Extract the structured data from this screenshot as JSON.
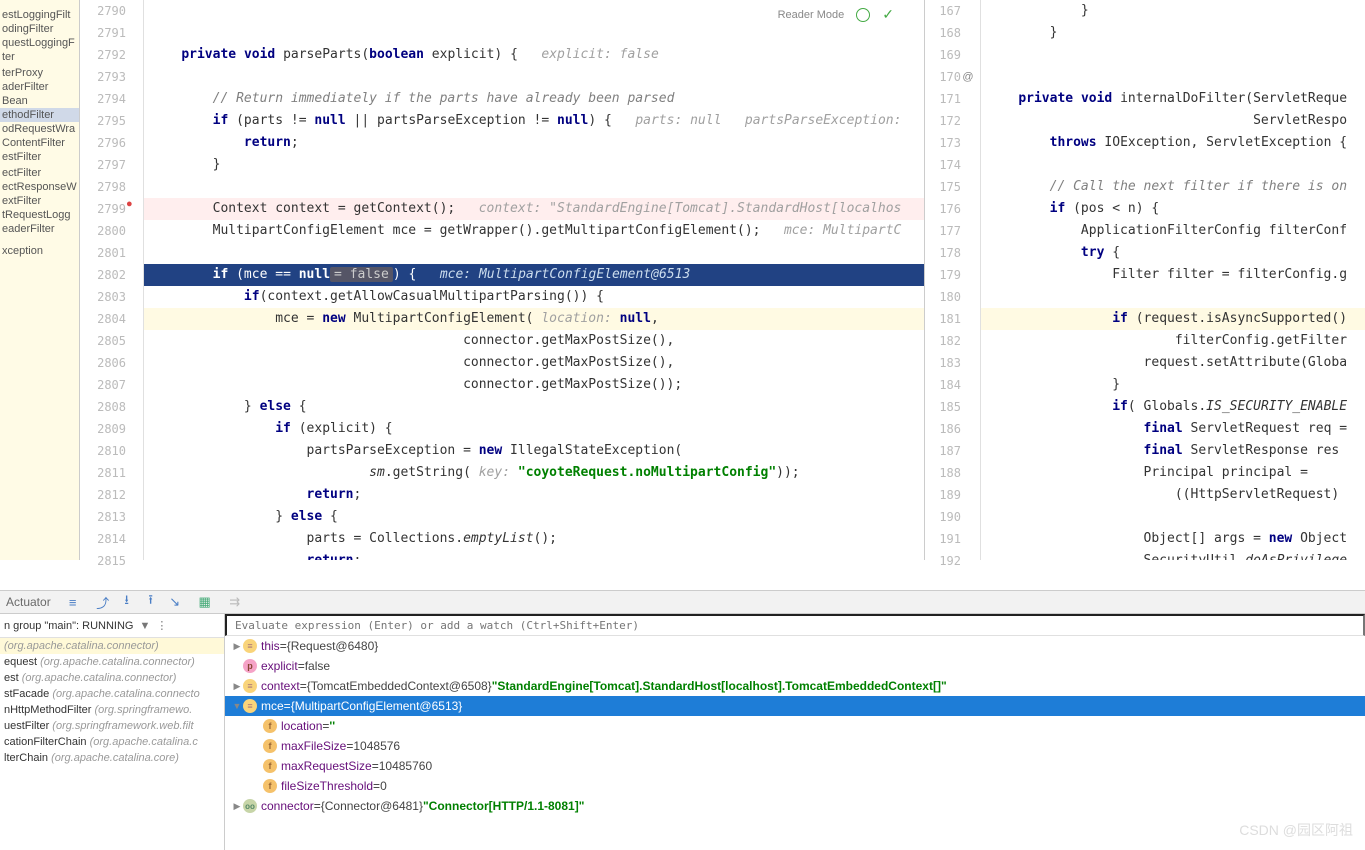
{
  "reader_mode": "Reader Mode",
  "structure": [
    {
      "t": ""
    },
    {
      "t": ""
    },
    {
      "t": "estLoggingFilt"
    },
    {
      "t": "odingFilter"
    },
    {
      "t": "questLoggingF"
    },
    {
      "t": "ter"
    },
    {
      "t": ""
    },
    {
      "t": "terProxy"
    },
    {
      "t": "aderFilter"
    },
    {
      "t": "Bean"
    },
    {
      "t": "ethodFilter",
      "sel": true
    },
    {
      "t": "odRequestWra"
    },
    {
      "t": "ContentFilter"
    },
    {
      "t": "estFilter"
    },
    {
      "t": ""
    },
    {
      "t": "ectFilter"
    },
    {
      "t": "ectResponseW"
    },
    {
      "t": "extFilter"
    },
    {
      "t": "tRequestLogg"
    },
    {
      "t": "eaderFilter"
    },
    {
      "t": ""
    },
    {
      "t": ""
    },
    {
      "t": ""
    },
    {
      "t": ""
    },
    {
      "t": "xception"
    }
  ],
  "leftGutterStart": 2790,
  "rightGutterStart": 167,
  "rightAnnotations": {
    "170": "@"
  },
  "leftLines": [
    {
      "tokens": [
        ""
      ]
    },
    {
      "tokens": [
        ""
      ]
    },
    {
      "tokens": [
        "    ",
        "private ",
        "kw",
        "void ",
        "kw",
        "parseParts(",
        "boolean ",
        "kw",
        "explicit) {   ",
        "explicit: false",
        "hint"
      ]
    },
    {
      "tokens": [
        ""
      ]
    },
    {
      "tokens": [
        "        ",
        "// Return immediately if the parts have already been parsed",
        "cm"
      ]
    },
    {
      "tokens": [
        "        ",
        "if ",
        "kw",
        "(parts != ",
        "null ",
        "kw",
        "|| partsParseException != ",
        "null",
        "kw",
        ") {   ",
        "parts: null   partsParseException:",
        "hint"
      ]
    },
    {
      "tokens": [
        "            ",
        "return",
        "kw",
        ";"
      ]
    },
    {
      "tokens": [
        "        }"
      ]
    },
    {
      "tokens": [
        ""
      ]
    },
    {
      "tokens": [
        "        Context context = getContext();   ",
        "context: \"StandardEngine[Tomcat].StandardHost[localhos",
        "hint"
      ],
      "bp": true
    },
    {
      "tokens": [
        "        MultipartConfigElement mce = getWrapper().getMultipartConfigElement();   ",
        "mce: MultipartC",
        "hint"
      ]
    },
    {
      "tokens": [
        ""
      ]
    },
    {
      "sel": true,
      "tokens": [
        "        ",
        "if ",
        "kw",
        "(mce == ",
        "null",
        "kw",
        "= false",
        "pill",
        ") {   ",
        "mce: MultipartConfigElement@6513",
        "hint"
      ]
    },
    {
      "tokens": [
        "            ",
        "if",
        "kw",
        "(context.getAllowCasualMultipartParsing()) {"
      ]
    },
    {
      "tokens": [
        "                mce = ",
        "new ",
        "kw",
        "MultipartConfigElement( ",
        "location: ",
        "hint",
        "null",
        "kw",
        ","
      ],
      "hl": true
    },
    {
      "tokens": [
        "                                        connector.getMaxPostSize(),"
      ]
    },
    {
      "tokens": [
        "                                        connector.getMaxPostSize(),"
      ]
    },
    {
      "tokens": [
        "                                        connector.getMaxPostSize());"
      ]
    },
    {
      "tokens": [
        "            } ",
        "else ",
        "kw",
        "{"
      ]
    },
    {
      "tokens": [
        "                ",
        "if ",
        "kw",
        "(explicit) {"
      ]
    },
    {
      "tokens": [
        "                    partsParseException = ",
        "new ",
        "kw",
        "IllegalStateException("
      ]
    },
    {
      "tokens": [
        "                            ",
        "sm",
        "hintit",
        ".getString( ",
        "key: ",
        "hint",
        "\"coyoteRequest.noMultipartConfig\"",
        "st",
        "));"
      ]
    },
    {
      "tokens": [
        "                    ",
        "return",
        "kw",
        ";"
      ]
    },
    {
      "tokens": [
        "                } ",
        "else ",
        "kw",
        "{"
      ]
    },
    {
      "tokens": [
        "                    parts = Collections.",
        "emptyList",
        "hintit",
        "();"
      ]
    },
    {
      "tokens": [
        "                    ",
        "return",
        "kw",
        ";"
      ]
    }
  ],
  "rightLines": [
    {
      "tokens": [
        "            }"
      ]
    },
    {
      "tokens": [
        "        }"
      ]
    },
    {
      "tokens": [
        ""
      ]
    },
    {
      "tokens": [
        ""
      ]
    },
    {
      "tokens": [
        "    ",
        "private ",
        "kw",
        "void ",
        "kw",
        "internalDoFilter(ServletReque"
      ]
    },
    {
      "tokens": [
        "                                  ServletRespo"
      ]
    },
    {
      "tokens": [
        "        ",
        "throws ",
        "kw",
        "IOException, ServletException {"
      ]
    },
    {
      "tokens": [
        ""
      ]
    },
    {
      "tokens": [
        "        ",
        "// Call the next filter if there is on",
        "cm"
      ]
    },
    {
      "tokens": [
        "        ",
        "if ",
        "kw",
        "(pos < n) {"
      ]
    },
    {
      "tokens": [
        "            ApplicationFilterConfig filterConf"
      ]
    },
    {
      "tokens": [
        "            ",
        "try ",
        "kw",
        "{"
      ]
    },
    {
      "tokens": [
        "                Filter filter = filterConfig.g"
      ]
    },
    {
      "tokens": [
        ""
      ]
    },
    {
      "tokens": [
        "                ",
        "if ",
        "kw",
        "(request.isAsyncSupported()"
      ],
      "hl": true
    },
    {
      "tokens": [
        "                        filterConfig.getFilter"
      ]
    },
    {
      "tokens": [
        "                    request.setAttribute(Globa"
      ]
    },
    {
      "tokens": [
        "                }"
      ]
    },
    {
      "tokens": [
        "                ",
        "if",
        "kw",
        "( Globals.",
        "IS_SECURITY_ENABLE",
        "hintit"
      ]
    },
    {
      "tokens": [
        "                    ",
        "final ",
        "kw",
        "ServletRequest req ="
      ]
    },
    {
      "tokens": [
        "                    ",
        "final ",
        "kw",
        "ServletResponse res"
      ]
    },
    {
      "tokens": [
        "                    Principal principal ="
      ]
    },
    {
      "tokens": [
        "                        ((HttpServletRequest)"
      ]
    },
    {
      "tokens": [
        ""
      ]
    },
    {
      "tokens": [
        "                    Object[] args = ",
        "new ",
        "kw",
        "Object"
      ]
    },
    {
      "tokens": [
        "                    SecurityUtil.",
        "doAsPrivilege",
        "hintit"
      ]
    }
  ],
  "actuator_label": "Actuator",
  "threadHeader": "n group \"main\": RUNNING",
  "frames": [
    {
      "m": "",
      "p": "(org.apache.catalina.connector)",
      "sel": true
    },
    {
      "m": "equest ",
      "p": "(org.apache.catalina.connector)"
    },
    {
      "m": "est ",
      "p": "(org.apache.catalina.connector)"
    },
    {
      "m": "stFacade ",
      "p": "(org.apache.catalina.connecto"
    },
    {
      "m": "nHttpMethodFilter ",
      "p": "(org.springframewo."
    },
    {
      "m": "uestFilter ",
      "p": "(org.springframework.web.filt"
    },
    {
      "m": "cationFilterChain ",
      "p": "(org.apache.catalina.c"
    },
    {
      "m": "lterChain ",
      "p": "(org.apache.catalina.core)"
    }
  ],
  "evalPlaceholder": "Evaluate expression (Enter) or add a watch (Ctrl+Shift+Enter)",
  "varsTree": [
    {
      "lvl": 0,
      "tw": ">",
      "ic": "o",
      "name": "this",
      "sep": " = ",
      "val": "{Request@6480}"
    },
    {
      "lvl": 0,
      "tw": "",
      "ic": "p",
      "name": "explicit",
      "sep": " = ",
      "val": "false"
    },
    {
      "lvl": 0,
      "tw": ">",
      "ic": "o",
      "name": "context",
      "sep": " = ",
      "val": "{TomcatEmbeddedContext@6508} ",
      "str": "\"StandardEngine[Tomcat].StandardHost[localhost].TomcatEmbeddedContext[]\""
    },
    {
      "lvl": 0,
      "tw": "v",
      "ic": "o",
      "name": "mce",
      "sep": " = ",
      "val": "{MultipartConfigElement@6513}",
      "sel": true
    },
    {
      "lvl": 1,
      "tw": "",
      "ic": "f",
      "name": "location",
      "sep": " = ",
      "str": "''"
    },
    {
      "lvl": 1,
      "tw": "",
      "ic": "f",
      "name": "maxFileSize",
      "sep": " = ",
      "val": "1048576"
    },
    {
      "lvl": 1,
      "tw": "",
      "ic": "f",
      "name": "maxRequestSize",
      "sep": " = ",
      "val": "10485760"
    },
    {
      "lvl": 1,
      "tw": "",
      "ic": "f",
      "name": "fileSizeThreshold",
      "sep": " = ",
      "val": "0"
    },
    {
      "lvl": 0,
      "tw": ">",
      "ic": "l",
      "name": "connector",
      "sep": " = ",
      "val": "{Connector@6481} ",
      "str": "\"Connector[HTTP/1.1-8081]\""
    }
  ],
  "watermark": "CSDN @园区阿祖"
}
